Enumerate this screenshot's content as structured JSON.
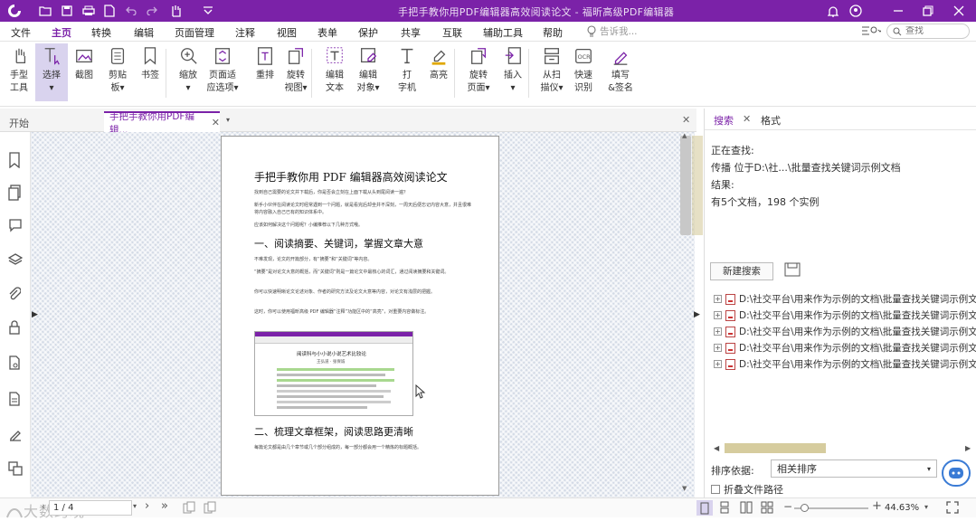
{
  "titlebar": {
    "title": "手把手教你用PDF编辑器高效阅读论文 - 福昕高级PDF编辑器"
  },
  "menubar": {
    "items": [
      "文件",
      "主页",
      "转换",
      "编辑",
      "页面管理",
      "注释",
      "视图",
      "表单",
      "保护",
      "共享",
      "互联",
      "辅助工具",
      "帮助"
    ],
    "tell_me": "告诉我...",
    "search_placeholder": "查找"
  },
  "ribbon": {
    "tools": [
      {
        "l1": "手型",
        "l2": "工具"
      },
      {
        "l1": "选择",
        "l2": "▾"
      },
      {
        "l1": "截图",
        "l2": ""
      },
      {
        "l1": "剪贴",
        "l2": "板▾"
      },
      {
        "l1": "书签",
        "l2": ""
      },
      {
        "l1": "缩放",
        "l2": "▾"
      },
      {
        "l1": "页面适",
        "l2": "应选项▾"
      },
      {
        "l1": "重排",
        "l2": ""
      },
      {
        "l1": "旋转",
        "l2": "视图▾"
      },
      {
        "l1": "编辑",
        "l2": "文本"
      },
      {
        "l1": "编辑",
        "l2": "对象▾"
      },
      {
        "l1": "打",
        "l2": "字机"
      },
      {
        "l1": "高亮",
        "l2": ""
      },
      {
        "l1": "旋转",
        "l2": "页面▾"
      },
      {
        "l1": "插入",
        "l2": "▾"
      },
      {
        "l1": "从扫",
        "l2": "描仪▾"
      },
      {
        "l1": "快速",
        "l2": "识别"
      },
      {
        "l1": "填写",
        "l2": "&签名"
      }
    ]
  },
  "tabs": {
    "start": "开始",
    "doc": "手把手教你用PDF编辑..."
  },
  "document": {
    "title": "手把手教你用 PDF 编辑器高效阅读论文",
    "intro1": "找到自己需要的论文并下载后，你是否会立刻在上面下载从头到尾阅读一遍？",
    "intro2": "新手小伙伴在阅读论文时经常遇到一个问题，就是看完后却坐并不深刻，一周天后便忘记内容大意，并且很难将内容融入自己已有的知识体系中。",
    "intro3": "应该如何解决这个问题呢？小编推荐以下几种方式哦。",
    "h1": "一、阅读摘要、关键词，掌握文章大意",
    "s1p1": "不难发现，论文的开篇部分，有“摘要”和“关键词”等内容。",
    "s1p2": "“摘要”是对论文大意的概括，而“关键词”则是一篇论文中最核心的词汇，通过阅读摘要和关键词。",
    "s1p3": "你可以快速明晰论文论述对象、作者的研究方法及论文大意等内容，对论文有浅层的把握。",
    "s1p4": "这时，你可以使用福昕高级 PDF 编辑器“注释”功能区中的“高亮”，对重要内容做标注。",
    "embedded_title": "阅读科与小小说小说艺术比较论",
    "embedded_sub": "王弘道 · 张保诚",
    "h2": "二、梳理文章框架，阅读思路更清晰",
    "s2p1": "每篇论文都是由几个章节或几个部分组成的，每一部分都会用一个精炼的标题概括。"
  },
  "search_panel": {
    "tab_search": "搜索",
    "tab_format": "格式",
    "searching_label": "正在查找:",
    "searching_value": "传播 位于D:\\社...\\批量查找关键词示例文档",
    "results_label": "结果:",
    "results_value": "有5个文档，198 个实例",
    "new_search": "新建搜索",
    "results": [
      "D:\\社交平台\\用来作为示例的文档\\批量查找关键词示例文",
      "D:\\社交平台\\用来作为示例的文档\\批量查找关键词示例文",
      "D:\\社交平台\\用来作为示例的文档\\批量查找关键词示例文",
      "D:\\社交平台\\用来作为示例的文档\\批量查找关键词示例文",
      "D:\\社交平台\\用来作为示例的文档\\批量查找关键词示例文"
    ],
    "sort_label": "排序依据:",
    "sort_value": "相关排序",
    "collapse_label": "折叠文件路径"
  },
  "statusbar": {
    "page": "1 / 4",
    "zoom": "44.63%"
  },
  "watermark": "大数跨境",
  "colors": {
    "brand": "#7b22a8",
    "selection": "#d9d3ee"
  }
}
